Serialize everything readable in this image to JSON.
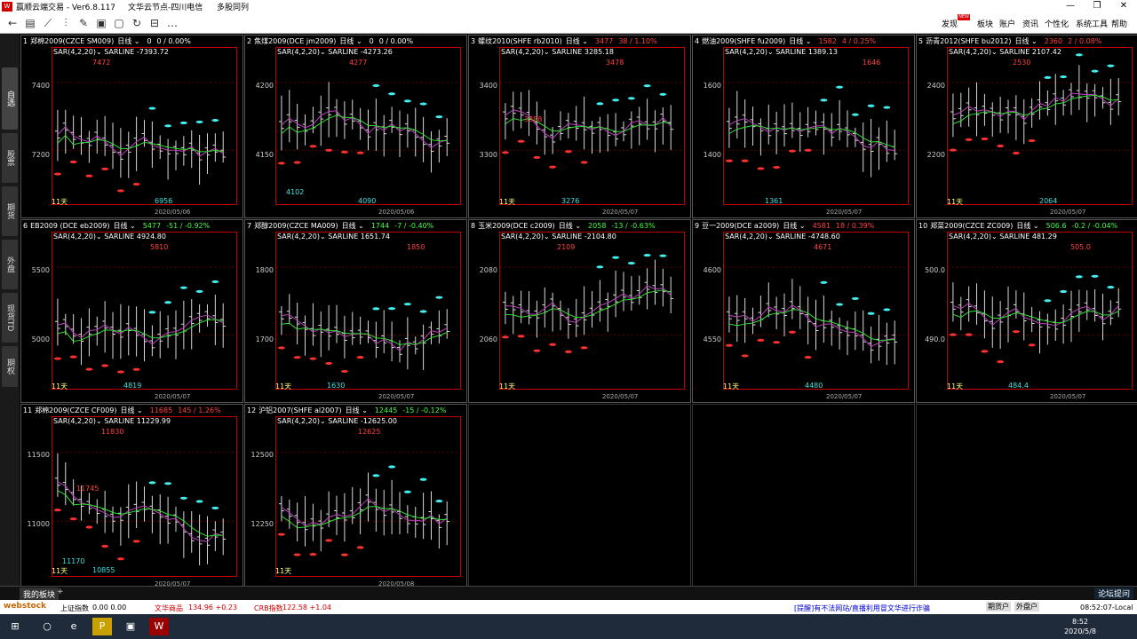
{
  "window": {
    "app_title": "赢顺云端交易 - Ver6.8.117",
    "node": "文华云节点-四川电信",
    "layout": "多股同列",
    "min": "—",
    "max": "❐",
    "close": "✕"
  },
  "toolbar": {
    "menus": [
      "发现",
      "板块",
      "账户",
      "资讯",
      "个性化",
      "系统工具",
      "帮助"
    ],
    "new_badge": "NEW"
  },
  "left_tabs": [
    "自选",
    "股票",
    "期货",
    "外盘",
    "现货TD",
    "期权"
  ],
  "charts": [
    {
      "num": "1",
      "name": "郑棉2009(CZCE SM009)",
      "period": "日线",
      "price": "0",
      "chg": "0 / 0.00%",
      "dir": "flat",
      "sar": "SARLINE -7393.72",
      "y": [
        "7400",
        "7200"
      ],
      "hi": "7472",
      "lo": "6956",
      "date": "2020/05/06",
      "days": "11天"
    },
    {
      "num": "2",
      "name": "焦煤2009(DCE jm2009)",
      "period": "日线",
      "price": "0",
      "chg": "0 / 0.00%",
      "dir": "flat",
      "sar": "SARLINE -4273.26",
      "y": [
        "4200",
        "4150"
      ],
      "hi": "4277",
      "lo": "4090",
      "lo2": "4102",
      "date": "2020/05/06",
      "days": ""
    },
    {
      "num": "3",
      "name": "螺纹2010(SHFE rb2010)",
      "period": "日线",
      "price": "3477",
      "chg": "38 / 1.10%",
      "dir": "up",
      "sar": "SARLINE 3285.18",
      "y": [
        "3400",
        "3300"
      ],
      "hi": "3478",
      "hi2": "3388",
      "lo": "3276",
      "date": "2020/05/07",
      "days": "11天"
    },
    {
      "num": "4",
      "name": "燃油2009(SHFE fu2009)",
      "period": "日线",
      "price": "1582",
      "chg": "4 / 0.25%",
      "dir": "up",
      "sar": "SARLINE 1389.13",
      "y": [
        "1600",
        "1400"
      ],
      "hi": "1646",
      "lo": "1361",
      "date": "2020/05/07",
      "days": ""
    },
    {
      "num": "5",
      "name": "沥青2012(SHFE bu2012)",
      "period": "日线",
      "price": "2360",
      "chg": "2 / 0.08%",
      "dir": "up",
      "sar": "SARLINE 2107.42",
      "y": [
        "2400",
        "2200"
      ],
      "hi": "2530",
      "lo": "2064",
      "date": "2020/05/07",
      "days": "11天"
    },
    {
      "num": "6",
      "name": "EB2009 (DCE eb2009)",
      "period": "日线",
      "price": "5477",
      "chg": "-51 / -0.92%",
      "dir": "down",
      "sar": "SARLINE 4924.80",
      "y": [
        "5500",
        "5000"
      ],
      "hi": "5810",
      "lo": "4819",
      "date": "2020/05/07",
      "days": "11天"
    },
    {
      "num": "7",
      "name": "郑醇2009(CZCE MA009)",
      "period": "日线",
      "price": "1744",
      "chg": "-7 / -0.40%",
      "dir": "down",
      "sar": "SARLINE 1651.74",
      "y": [
        "1800",
        "1700"
      ],
      "hi": "1850",
      "lo": "1630",
      "date": "2020/05/07",
      "days": "11天"
    },
    {
      "num": "8",
      "name": "玉米2009(DCE c2009)",
      "period": "日线",
      "price": "2058",
      "chg": "-13 / -0.63%",
      "dir": "down",
      "sar": "SARLINE -2104.80",
      "y": [
        "2080",
        "2060"
      ],
      "hi": "2109",
      "lo": "",
      "date": "2020/05/07",
      "days": "11天"
    },
    {
      "num": "9",
      "name": "豆一2009(DCE a2009)",
      "period": "日线",
      "price": "4581",
      "chg": "18 / 0.39%",
      "dir": "up",
      "sar": "SARLINE -4748.60",
      "y": [
        "4600",
        "4550"
      ],
      "hi": "4671",
      "lo": "4480",
      "date": "2020/05/07",
      "days": "11天"
    },
    {
      "num": "10",
      "name": "郑菜2009(CZCE ZC009)",
      "period": "日线",
      "price": "506.6",
      "chg": "-0.2 / -0.04%",
      "dir": "down",
      "sar": "SARLINE 481.29",
      "y": [
        "500.0",
        "490.0"
      ],
      "hi": "505.0",
      "lo": "484.4",
      "date": "2020/05/07",
      "days": "11天"
    },
    {
      "num": "11",
      "name": "郑棉2009(CZCE CF009)",
      "period": "日线",
      "price": "11685",
      "chg": "145 / 1.26%",
      "dir": "up",
      "sar": "SARLINE 11229.99",
      "y": [
        "11500",
        "11000"
      ],
      "hi": "11830",
      "hi2": "11745",
      "lo": "10855",
      "lo2": "11170",
      "date": "2020/05/07",
      "days": "11天"
    },
    {
      "num": "12",
      "name": "沪铝2007(SHFE al2007)",
      "period": "日线",
      "price": "12445",
      "chg": "-15 / -0.12%",
      "dir": "down",
      "sar": "SARLINE -12625.00",
      "y": [
        "12500",
        "12250"
      ],
      "hi": "12625",
      "lo": "",
      "date": "2020/05/08",
      "days": "11天"
    }
  ],
  "indicator": "SAR(4,2,20)",
  "bottom_tabs": {
    "active": "我的板块",
    "add": "+",
    "forum": "论坛提问"
  },
  "status": {
    "brand": "webstock",
    "sh_label": "上证指数",
    "sh_val": "0.00  0.00",
    "wh_label": "文华商品",
    "wh_val": "134.96  +0.23",
    "crb_label": "CRB指数",
    "crb_val": "122.58  +1.04",
    "notice": "[提醒]有不法网站/直播利用冒文华进行诈骗",
    "futures_acct": "期货户",
    "ext_acct": "外盘户",
    "time": "08:52:07-Local"
  },
  "taskbar": {
    "time": "8:52",
    "date": "2020/5/8"
  }
}
